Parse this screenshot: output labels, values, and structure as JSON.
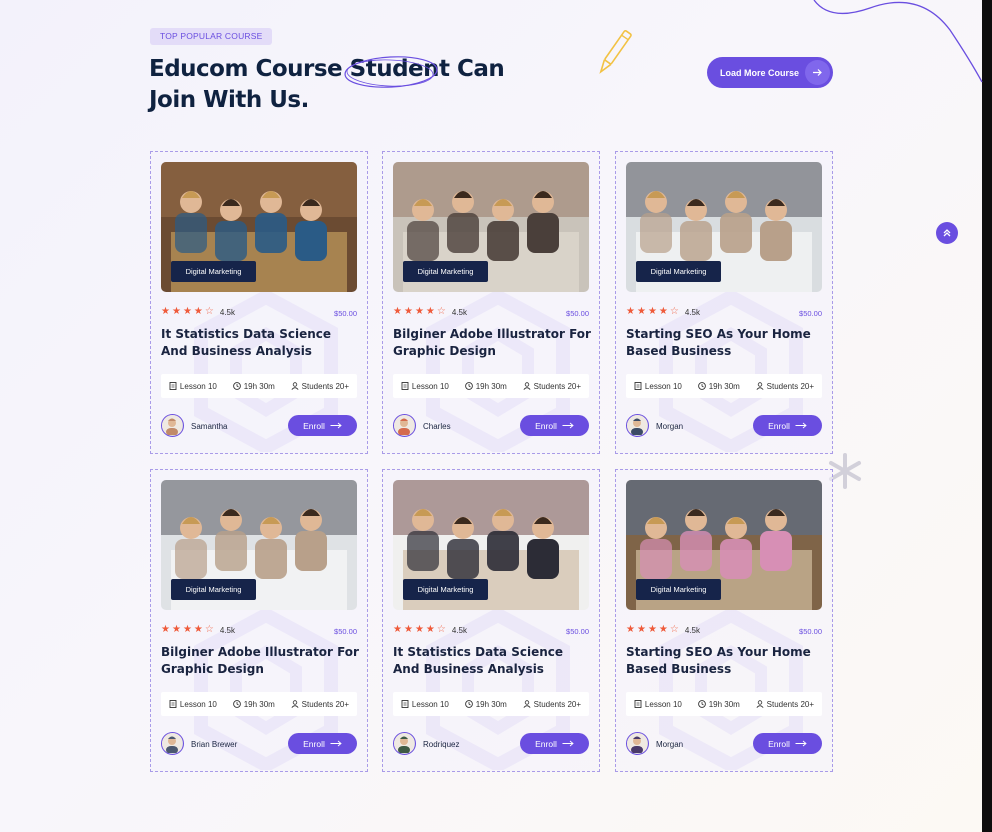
{
  "header": {
    "badge": "TOP POPULAR COURSE",
    "title_line1": "Educom Course Student Can",
    "title_line2": "Join With Us.",
    "load_more_label": "Load More Course"
  },
  "colors": {
    "accent": "#6a4ee0",
    "star": "#ef5a3a",
    "tag_bg": "#16244a",
    "title": "#0f2240"
  },
  "courses": [
    {
      "category": "Digital Marketing",
      "rating": "4.5k",
      "price": "$50.00",
      "title": "It Statistics Data Science And Business Analysis",
      "lessons": "Lesson 10",
      "duration": "19h 30m",
      "students": "Students 20+",
      "author": "Samantha",
      "enroll": "Enroll"
    },
    {
      "category": "Digital Marketing",
      "rating": "4.5k",
      "price": "$50.00",
      "title": "Bilginer Adobe Illustrator For Graphic Design",
      "lessons": "Lesson 10",
      "duration": "19h 30m",
      "students": "Students 20+",
      "author": "Charles",
      "enroll": "Enroll"
    },
    {
      "category": "Digital Marketing",
      "rating": "4.5k",
      "price": "$50.00",
      "title": "Starting SEO As Your Home Based Business",
      "lessons": "Lesson 10",
      "duration": "19h 30m",
      "students": "Students 20+",
      "author": "Morgan",
      "enroll": "Enroll"
    },
    {
      "category": "Digital Marketing",
      "rating": "4.5k",
      "price": "$50.00",
      "title": "Bilginer Adobe Illustrator For Graphic Design",
      "lessons": "Lesson 10",
      "duration": "19h 30m",
      "students": "Students 20+",
      "author": "Brian Brewer",
      "enroll": "Enroll"
    },
    {
      "category": "Digital Marketing",
      "rating": "4.5k",
      "price": "$50.00",
      "title": "It Statistics Data Science And Business Analysis",
      "lessons": "Lesson 10",
      "duration": "19h 30m",
      "students": "Students 20+",
      "author": "Rodriquez",
      "enroll": "Enroll"
    },
    {
      "category": "Digital Marketing",
      "rating": "4.5k",
      "price": "$50.00",
      "title": "Starting SEO As Your Home Based Business",
      "lessons": "Lesson 10",
      "duration": "19h 30m",
      "students": "Students 20+",
      "author": "Morgan",
      "enroll": "Enroll"
    }
  ],
  "star_rating": {
    "filled": 4,
    "total": 5
  },
  "icons": {
    "scroll_top": "double-chevron-up-icon",
    "lesson": "document-icon",
    "duration": "clock-icon",
    "students": "user-icon",
    "enroll_arrow": "arrow-right-icon"
  }
}
